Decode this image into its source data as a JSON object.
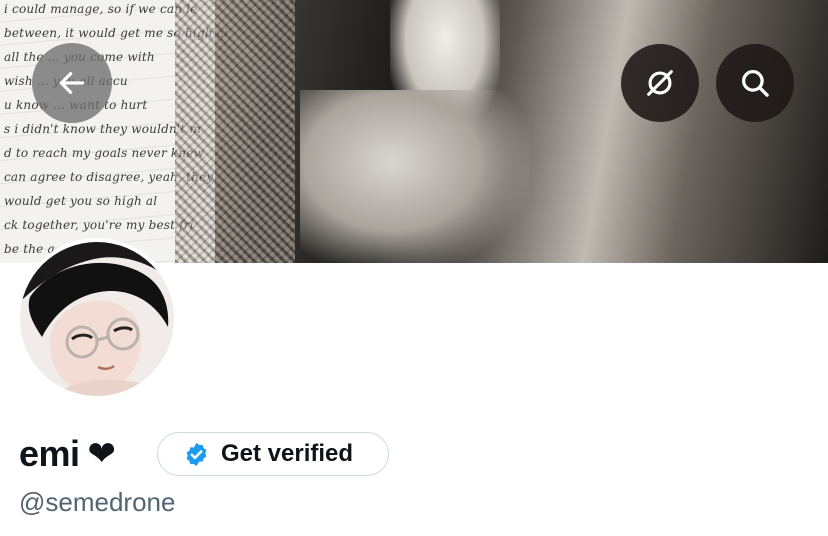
{
  "banner": {
    "scribble_lines": [
      "i could manage, so if we can le",
      "between, it would get me so high al",
      "all the ... you come with",
      "wish ... you all accu",
      "u know ... want to hurt",
      "s i didn't know they wouldn't m",
      "d to reach my goals never knew",
      "can agree to disagree, yeah, they",
      "would get you so high al",
      "ck together, you're my best fri",
      "be the a"
    ]
  },
  "nav": {
    "back_icon": "arrow-left-icon",
    "hide_icon": "eye-slash-circle-icon",
    "search_icon": "search-icon"
  },
  "profile": {
    "display_name": "emi",
    "name_emoji": "❤",
    "verify_label": "Get verified",
    "verify_icon": "verified-badge-icon",
    "verify_color": "#1d9bf0",
    "handle": "@semedrone"
  }
}
